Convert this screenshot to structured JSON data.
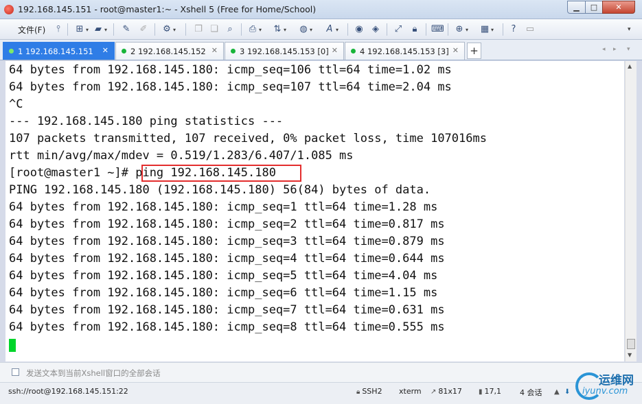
{
  "window": {
    "title": "192.168.145.151 - root@master1:~ - Xshell 5 (Free for Home/School)",
    "buttons": {
      "minimize": "▁",
      "maximize": "□",
      "close": "✕"
    }
  },
  "toolbar": {
    "file_menu": "文件(F)",
    "icons": [
      "pin-icon",
      "new-session-icon",
      "open-folder-icon",
      "reconnect-icon",
      "disconnect-icon",
      "properties-icon",
      "copy-icon",
      "paste-icon",
      "find-icon",
      "print-icon",
      "transfer-icon",
      "globe-icon",
      "font-icon",
      "xshell-icon",
      "xftp-icon",
      "fullscreen-icon",
      "lock-icon",
      "keyboard-icon",
      "add-icon",
      "layout-icon",
      "help-icon",
      "chat-icon"
    ]
  },
  "tabs": [
    {
      "label": "1 192.168.145.151",
      "active": true
    },
    {
      "label": "2 192.168.145.152",
      "active": false
    },
    {
      "label": "3 192.168.145.153 [0]",
      "active": false
    },
    {
      "label": "4 192.168.145.153 [3]",
      "active": false
    }
  ],
  "tab_add": "+",
  "terminal": {
    "lines": [
      "64 bytes from 192.168.145.180: icmp_seq=106 ttl=64 time=1.02 ms",
      "64 bytes from 192.168.145.180: icmp_seq=107 ttl=64 time=2.04 ms",
      "^C",
      "--- 192.168.145.180 ping statistics ---",
      "107 packets transmitted, 107 received, 0% packet loss, time 107016ms",
      "rtt min/avg/max/mdev = 0.519/1.283/6.407/1.085 ms",
      "[root@master1 ~]# ping 192.168.145.180",
      "PING 192.168.145.180 (192.168.145.180) 56(84) bytes of data.",
      "64 bytes from 192.168.145.180: icmp_seq=1 ttl=64 time=1.28 ms",
      "64 bytes from 192.168.145.180: icmp_seq=2 ttl=64 time=0.817 ms",
      "64 bytes from 192.168.145.180: icmp_seq=3 ttl=64 time=0.879 ms",
      "64 bytes from 192.168.145.180: icmp_seq=4 ttl=64 time=0.644 ms",
      "64 bytes from 192.168.145.180: icmp_seq=5 ttl=64 time=4.04 ms",
      "64 bytes from 192.168.145.180: icmp_seq=6 ttl=64 time=1.15 ms",
      "64 bytes from 192.168.145.180: icmp_seq=7 ttl=64 time=0.631 ms",
      "64 bytes from 192.168.145.180: icmp_seq=8 ttl=64 time=0.555 ms"
    ],
    "cursor_color": "#00d52a",
    "highlight_color": "#e32d2d"
  },
  "compose": {
    "placeholder": "发送文本到当前Xshell窗口的全部会话"
  },
  "status": {
    "connection": "ssh://root@192.168.145.151:22",
    "protocol": "SSH2",
    "terminal_type": "xterm",
    "size": "81x17",
    "position": "17,1",
    "sessions": "4 会话"
  },
  "watermark": {
    "cn": "运维网",
    "en": "iyunv.com"
  },
  "colors": {
    "active_tab": "#2f7de6",
    "session_dot": "#18b43a"
  }
}
